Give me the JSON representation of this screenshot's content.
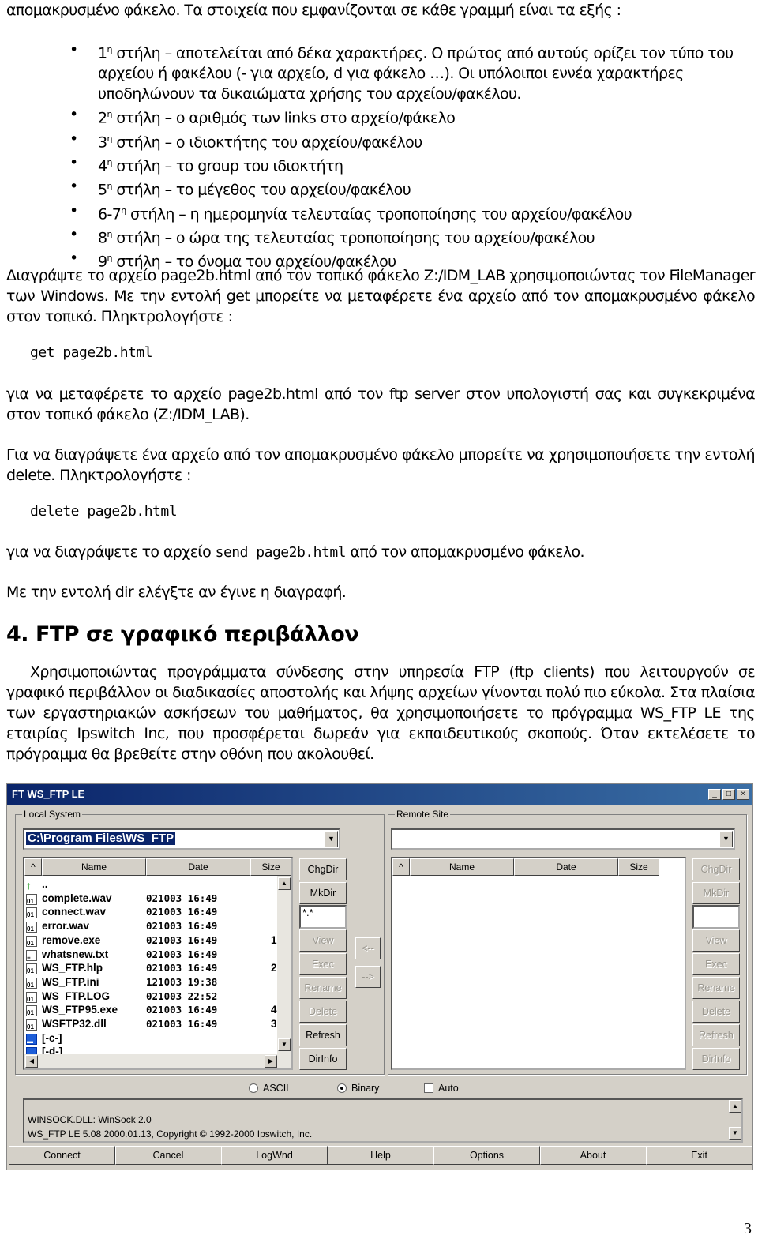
{
  "intro": "απομακρυσμένο φάκελο. Τα στοιχεία που εμφανίζονται σε κάθε γραμμή είναι τα εξής :",
  "bullets": [
    {
      "num": "1",
      "sup": "η",
      "text": " στήλη – αποτελείται από δέκα χαρακτήρες. Ο πρώτος από αυτούς ορίζει τον τύπο του αρχείου ή φακέλου (- για αρχείο, d για φάκελο …). Οι υπόλοιποι εννέα χαρακτήρες υποδηλώνουν τα δικαιώματα χρήσης του αρχείου/φακέλου."
    },
    {
      "num": "2",
      "sup": "η",
      "text": " στήλη – ο αριθμός των links στο αρχείο/φάκελο"
    },
    {
      "num": "3",
      "sup": "η",
      "text": " στήλη – ο ιδιοκτήτης του αρχείου/φακέλου"
    },
    {
      "num": "4",
      "sup": "η",
      "text": " στήλη – το group του ιδιοκτήτη"
    },
    {
      "num": "5",
      "sup": "η",
      "text": " στήλη – το μέγεθος του αρχείου/φακέλου"
    },
    {
      "num": "6-7",
      "sup": "η",
      "text": " στήλη – η ημερομηνία τελευταίας τροποποίησης του αρχείου/φακέλου"
    },
    {
      "num": "8",
      "sup": "η",
      "text": " στήλη – ο ώρα της τελευταίας τροποποίησης του αρχείου/φακέλου"
    },
    {
      "num": "9",
      "sup": "η",
      "text": " στήλη – το όνομα του αρχείου/φακέλου"
    }
  ],
  "p1": "Διαγράψτε το αρχείο page2b.html από τον τοπικό φάκελο Z:/IDM_LAB χρησιμοποιώντας τον FileManager των Windows. Με την εντολή get μπορείτε να μεταφέρετε ένα αρχείο από τον απομακρυσμένο φάκελο στον τοπικό. Πληκτρολογήστε :",
  "cmd_get": "get page2b.html",
  "p2": "για να μεταφέρετε το αρχείο page2b.html από τον ftp server στον υπολογιστή σας και συγκεκριμένα στον τοπικό φάκελο (Z:/IDM_LAB).",
  "p3": "Για να διαγράψετε ένα αρχείο από τον απομακρυσμένο φάκελο μπορείτε να χρησιμοποιήσετε την εντολή delete. Πληκτρολογήστε :",
  "cmd_delete": "delete page2b.html",
  "p4a": "για να διαγράψετε το αρχείο ",
  "p4code": "send page2b.html",
  "p4b": " από τον απομακρυσμένο φάκελο.",
  "p5": "Με την εντολή dir ελέγξτε αν έγινε η διαγραφή.",
  "heading": "4. FTP σε γραφικό περιβάλλον",
  "p6": "Χρησιμοποιώντας προγράμματα σύνδεσης στην υπηρεσία FTP (ftp clients) που λειτουργούν σε γραφικό περιβάλλον οι διαδικασίες αποστολής και λήψης αρχείων γίνονται πολύ πιο εύκολα. Στα πλαίσια των εργαστηριακών ασκήσεων του μαθήματος, θα χρησιμοποιήσετε το πρόγραμμα WS_FTP LE της εταιρίας Ipswitch Inc, που προσφέρεται δωρεάν για εκπαιδευτικούς σκοπούς. Όταν εκτελέσετε το πρόγραμμα θα βρεθείτε στην οθόνη που ακολουθεί.",
  "page_number": "3",
  "ftp": {
    "title": "WS_FTP LE",
    "local_label": "Local System",
    "remote_label": "Remote Site",
    "local_path": "C:\\Program Files\\WS_FTP",
    "cols": [
      "Name",
      "Date",
      "Size"
    ],
    "files": [
      {
        "icon": "folder-up",
        "name": "..",
        "date": "",
        "size": ""
      },
      {
        "icon": "file",
        "name": "complete.wav",
        "date": "021003 16:49",
        "size": ""
      },
      {
        "icon": "file",
        "name": "connect.wav",
        "date": "021003 16:49",
        "size": ""
      },
      {
        "icon": "file",
        "name": "error.wav",
        "date": "021003 16:49",
        "size": ""
      },
      {
        "icon": "file",
        "name": "remove.exe",
        "date": "021003 16:49",
        "size": "1"
      },
      {
        "icon": "text-file",
        "name": "whatsnew.txt",
        "date": "021003 16:49",
        "size": ""
      },
      {
        "icon": "file",
        "name": "WS_FTP.hlp",
        "date": "021003 16:49",
        "size": "2"
      },
      {
        "icon": "file",
        "name": "WS_FTP.ini",
        "date": "121003 19:38",
        "size": ""
      },
      {
        "icon": "file",
        "name": "WS_FTP.LOG",
        "date": "021003 22:52",
        "size": ""
      },
      {
        "icon": "file",
        "name": "WS_FTP95.exe",
        "date": "021003 16:49",
        "size": "4"
      },
      {
        "icon": "file",
        "name": "WSFTP32.dll",
        "date": "021003 16:49",
        "size": "3"
      },
      {
        "icon": "drive",
        "name": "[-c-]",
        "date": "",
        "size": ""
      },
      {
        "icon": "drive",
        "name": "[-d-]",
        "date": "",
        "size": ""
      }
    ],
    "filter": "*.*",
    "local_buttons": [
      {
        "label": "ChgDir",
        "enabled": true
      },
      {
        "label": "MkDir",
        "enabled": true
      },
      {
        "label": "View",
        "enabled": false
      },
      {
        "label": "Exec",
        "enabled": false
      },
      {
        "label": "Rename",
        "enabled": false
      },
      {
        "label": "Delete",
        "enabled": false
      },
      {
        "label": "Refresh",
        "enabled": true
      },
      {
        "label": "DirInfo",
        "enabled": true
      }
    ],
    "remote_buttons": [
      "ChgDir",
      "MkDir",
      "View",
      "Exec",
      "Rename",
      "Delete",
      "Refresh",
      "DirInfo"
    ],
    "arrow_left": "<--",
    "arrow_right": "-->",
    "modes": {
      "ascii": "ASCII",
      "binary": "Binary",
      "auto": "Auto",
      "selected": "Binary",
      "auto_checked": false
    },
    "log": [
      "WINSOCK.DLL: WinSock 2.0",
      "WS_FTP LE 5.08 2000.01.13, Copyright © 1992-2000 Ipswitch, Inc."
    ],
    "bottom_buttons": [
      "Connect",
      "Cancel",
      "LogWnd",
      "Help",
      "Options",
      "About",
      "Exit"
    ]
  }
}
